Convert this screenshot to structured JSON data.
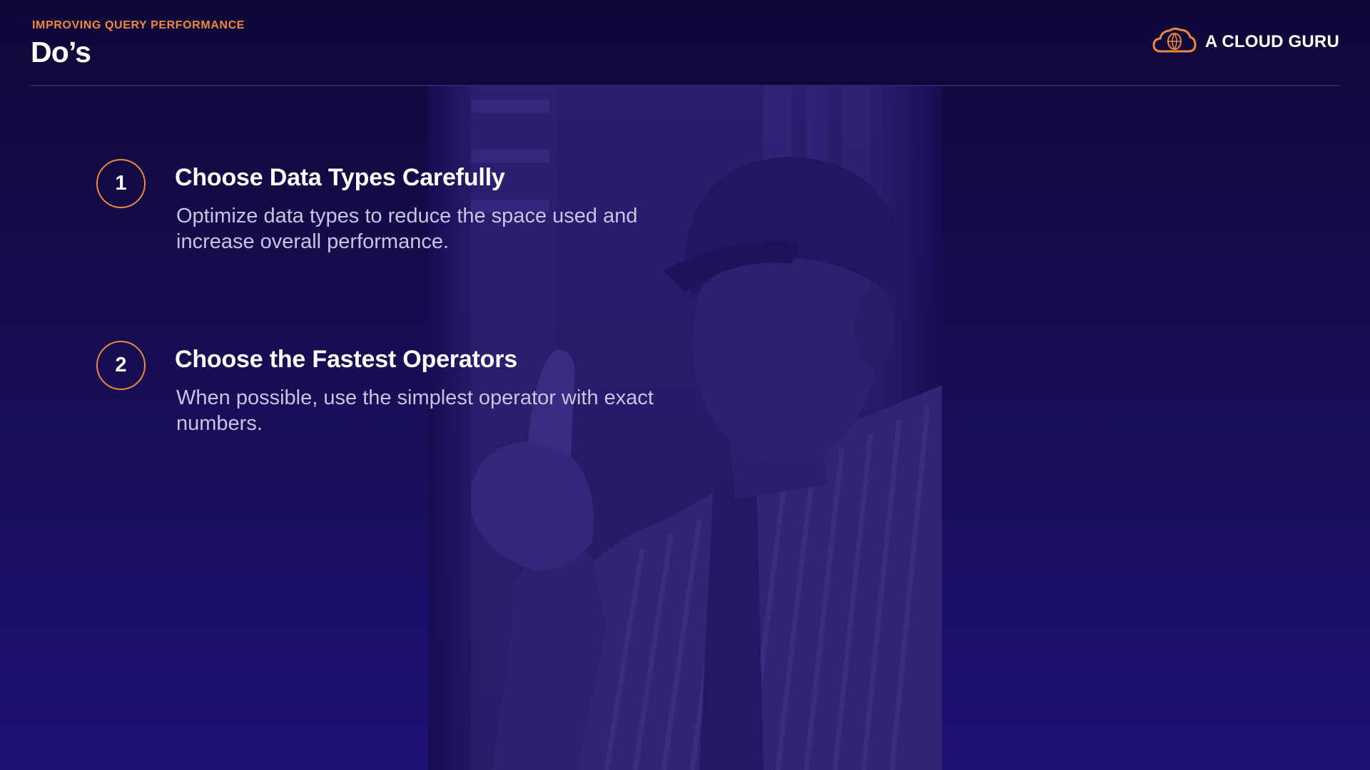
{
  "header": {
    "eyebrow": "IMPROVING QUERY PERFORMANCE",
    "title": "Do’s"
  },
  "brand": {
    "name": "A CLOUD GURU",
    "icon": "cloud-logo-icon",
    "accent_color": "#f0873a"
  },
  "items": [
    {
      "number": "1",
      "title": "Choose Data Types Carefully",
      "description": "Optimize data types to reduce the space used and increase overall performance."
    },
    {
      "number": "2",
      "title": "Choose the Fastest Operators",
      "description": "When possible, use the simplest operator with exact numbers."
    }
  ],
  "colors": {
    "background": "#160d52",
    "accent": "#f0873a",
    "text": "#ffffff",
    "muted_text": "#c9c3e3"
  }
}
